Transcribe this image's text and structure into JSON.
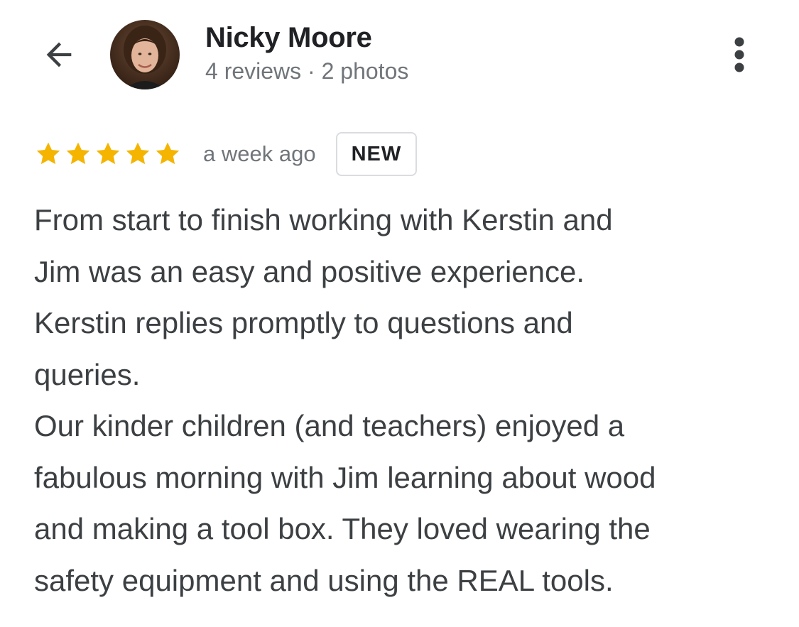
{
  "header": {
    "back_icon": "arrow-back-icon",
    "author_name": "Nicky Moore",
    "author_meta": "4 reviews · 2 photos",
    "more_icon": "more-vert-icon"
  },
  "review": {
    "rating": 5,
    "rating_max": 5,
    "star_color": "#f4b400",
    "date": "a week ago",
    "badge": "NEW",
    "body_lines": [
      "From start to finish working with Kerstin and",
      "Jim was an easy and positive experience.",
      "Kerstin replies promptly to questions and",
      "queries.",
      "Our kinder children (and teachers) enjoyed a",
      "fabulous morning with Jim learning about wood",
      "and making a tool box. They loved wearing the",
      "safety equipment and using the REAL tools."
    ]
  }
}
